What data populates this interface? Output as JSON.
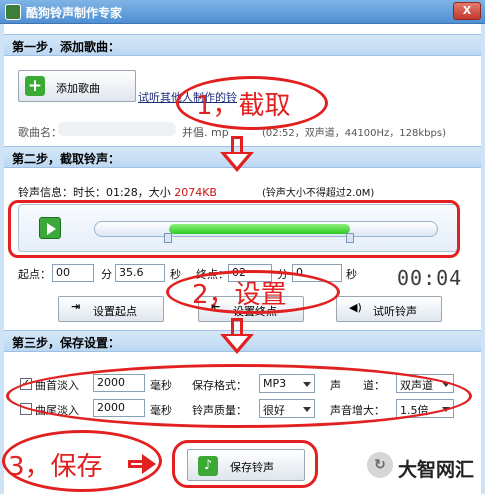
{
  "window": {
    "title": "酷狗铃声制作专家",
    "close": "X"
  },
  "step1": {
    "header": "第一步，添加歌曲：",
    "add_button": "添加歌曲",
    "preview_link": "试听其他人制作的铃",
    "song_name_label": "歌曲名：",
    "song_info_partial": "并倡. mp",
    "song_format": "(02:52，双声道，44100Hz，128kbps)"
  },
  "step2": {
    "header": "第二步，截取铃声：",
    "info_prefix": "铃声信息：时长：01:28，大小",
    "info_size": "2074KB",
    "info_limit": "(铃声大小不得超过2.0M)",
    "start_label": "起点：",
    "start_min": "00",
    "min_unit": "分",
    "start_sec": "35.6",
    "sec_unit": "秒",
    "end_label": "终点：",
    "end_min": "02",
    "end_sec": "0",
    "timer": "00:04",
    "selection_start": 0.215,
    "selection_end": 0.745,
    "set_start_button": "设置起点",
    "set_end_button": "设置终点",
    "listen_button": "试听铃声"
  },
  "step3": {
    "header": "第三步，保存设置：",
    "fade_in_label": "曲首淡入",
    "fade_in_checked": true,
    "fade_in_value": "2000",
    "fade_out_label": "曲尾淡入",
    "fade_out_checked": false,
    "fade_out_value": "2000",
    "ms_unit": "毫秒",
    "format_label": "保存格式：",
    "format_value": "MP3",
    "channel_label": "声　　道：",
    "channel_value": "双声道",
    "quality_label": "铃声质量：",
    "quality_value": "很好",
    "volume_label": "声音增大：",
    "volume_value": "1.5倍",
    "save_button": "保存铃声"
  },
  "annotations": {
    "cut": "1，截取",
    "settings": "2，设置",
    "save": "3，保存"
  },
  "watermark": {
    "icon": "↻",
    "text": "大智网汇"
  },
  "colors": {
    "annotation_red": "#e22020",
    "size_red": "#d11111",
    "accent_green": "#2ecb24"
  }
}
